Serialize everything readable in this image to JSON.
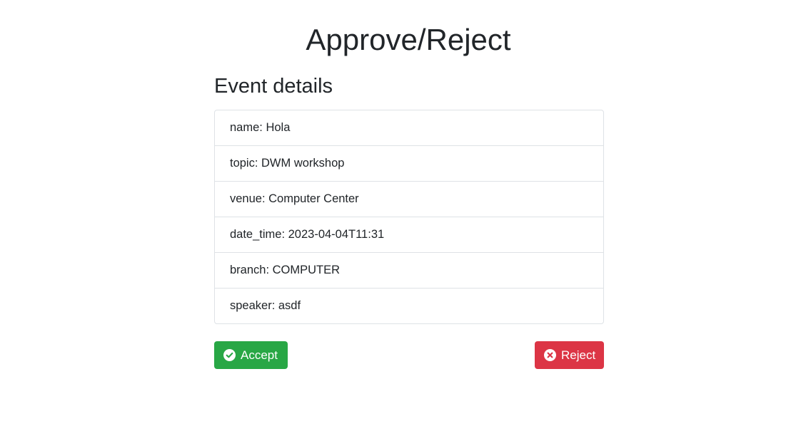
{
  "page": {
    "title": "Approve/Reject"
  },
  "event": {
    "heading": "Event details",
    "fields": [
      "name: Hola",
      "topic: DWM workshop",
      "venue: Computer Center",
      "date_time: 2023-04-04T11:31",
      "branch: COMPUTER",
      "speaker: asdf"
    ]
  },
  "actions": {
    "accept_label": "Accept",
    "accept_icon": "check-circle-icon",
    "reject_label": "Reject",
    "reject_icon": "x-circle-icon"
  },
  "colors": {
    "accept": "#28a745",
    "reject": "#dc3545",
    "border": "#dee2e6",
    "text": "#212529"
  }
}
